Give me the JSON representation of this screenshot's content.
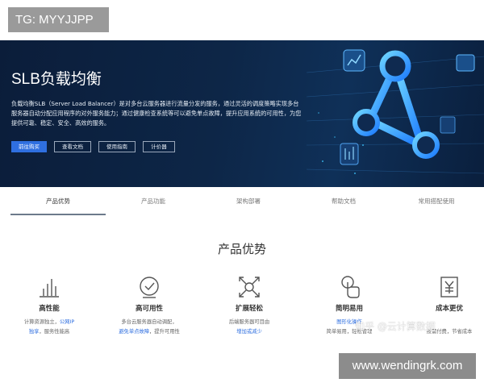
{
  "tag": "TG: MYYJJPP",
  "hero": {
    "title": "SLB负载均衡",
    "description": "负载均衡SLB（Server Load Balancer）是对多台云服务器进行流量分发的服务，通过灵活的调度策略实现多台服务器自动分配应用程序的对外服务能力；通过健康检查系统等可以避免单点故障，提升应用系统的可用性，为您提供可靠、稳定、安全、高效的服务。",
    "buttons": [
      "前往购买",
      "查看文档",
      "使用指南",
      "计价器"
    ],
    "colors": {
      "primary_button": "#2f6fe0",
      "art_accent": "#1fa3ff"
    }
  },
  "tabs": [
    "产品优势",
    "产品功能",
    "架构部署",
    "帮助文档",
    "常用搭配使用"
  ],
  "section": {
    "title": "产品优势",
    "features": [
      {
        "icon": "bar-chart-icon",
        "title": "高性能",
        "desc_pre": "计算资源独立，",
        "desc_hl": "公网IP",
        "desc_hl2": "独享",
        "desc_post": "，服务性能高"
      },
      {
        "icon": "shield-check-icon",
        "title": "高可用性",
        "desc_pre": "多台云服务器自动调配，",
        "desc_hl": "",
        "desc_hl2": "避免单点故障",
        "desc_post": "，提升可用性"
      },
      {
        "icon": "expand-arrows-icon",
        "title": "扩展轻松",
        "desc_pre": "后端服务器可目由",
        "desc_hl": "",
        "desc_hl2": "增加或减少",
        "desc_post": ""
      },
      {
        "icon": "touch-click-icon",
        "title": "简明易用",
        "desc_pre": "",
        "desc_hl": "图形化操作",
        "desc_hl2": "",
        "desc_post": "简单易用，轻松管理"
      },
      {
        "icon": "yen-document-icon",
        "title": "成本更优",
        "desc_pre": "",
        "desc_hl": "",
        "desc_hl2": "",
        "desc_post": "按需付费，节省成本"
      }
    ]
  },
  "watermarks": {
    "zhihu": "知乎 @云计算数据",
    "site": "www.wendingrk.com"
  }
}
